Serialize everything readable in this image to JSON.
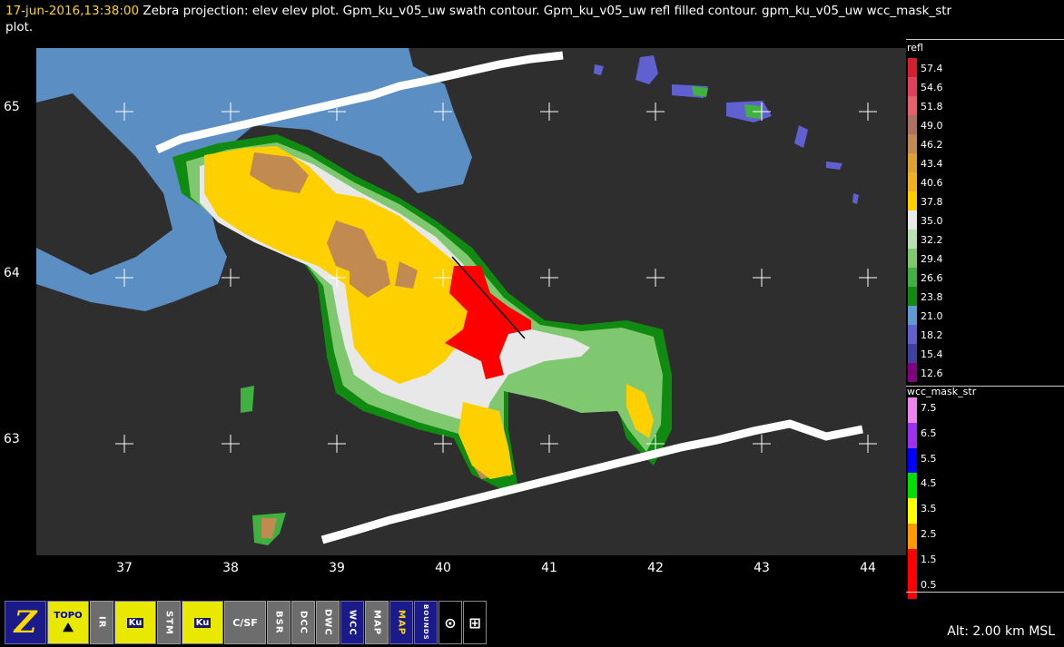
{
  "title": {
    "timestamp": "17-jun-2016,13:38:00",
    "description_line1": "  Zebra projection: elev elev  plot.  Gpm_ku_v05_uw swath contour.  Gpm_ku_v05_uw refl filled contour.  gpm_ku_v05_uw wcc_mask_str",
    "description_line2": "plot."
  },
  "axes": {
    "y_ticks": [
      "65",
      "64",
      "63"
    ],
    "x_ticks": [
      "37",
      "38",
      "39",
      "40",
      "41",
      "42",
      "43",
      "44"
    ]
  },
  "legend_refl": {
    "title": "refl",
    "entries": [
      {
        "label": "57.4",
        "color": "#d3202e"
      },
      {
        "label": "54.6",
        "color": "#e0405a"
      },
      {
        "label": "51.8",
        "color": "#e8606a"
      },
      {
        "label": "49.0",
        "color": "#b07060"
      },
      {
        "label": "46.2",
        "color": "#c08a50"
      },
      {
        "label": "43.4",
        "color": "#e0a030"
      },
      {
        "label": "40.6",
        "color": "#f0b020"
      },
      {
        "label": "37.8",
        "color": "#ffd000"
      },
      {
        "label": "35.0",
        "color": "#e8e8e8"
      },
      {
        "label": "32.2",
        "color": "#b8e0b0"
      },
      {
        "label": "29.4",
        "color": "#80c870"
      },
      {
        "label": "26.6",
        "color": "#40b040"
      },
      {
        "label": "23.8",
        "color": "#108a10"
      },
      {
        "label": "21.0",
        "color": "#5f9bd0"
      },
      {
        "label": "18.2",
        "color": "#6060d0"
      },
      {
        "label": "15.4",
        "color": "#4040a0"
      },
      {
        "label": "12.6",
        "color": "#800080"
      }
    ]
  },
  "legend_wcc": {
    "title": "wcc_mask_str",
    "entries": [
      {
        "label": "7.5",
        "color": "#ee82ee"
      },
      {
        "label": "6.5",
        "color": "#a030f0"
      },
      {
        "label": "5.5",
        "color": "#0000ff"
      },
      {
        "label": "4.5",
        "color": "#00e000"
      },
      {
        "label": "3.5",
        "color": "#ffff00"
      },
      {
        "label": "2.5",
        "color": "#ff9900"
      },
      {
        "label": "1.5",
        "color": "#ff0000"
      },
      {
        "label": "0.5",
        "color": "#ff0000"
      }
    ]
  },
  "toolbar": {
    "buttons": [
      {
        "name": "zebra-logo-button",
        "label": "Z"
      },
      {
        "name": "topo-button",
        "label": "TOPO"
      },
      {
        "name": "ir-button",
        "label": "IR"
      },
      {
        "name": "ku-button",
        "label": "Ku"
      },
      {
        "name": "stm-button",
        "label": "STM"
      },
      {
        "name": "ku-vs-button",
        "label": "Ku"
      },
      {
        "name": "csf-button",
        "label": "C/SF"
      },
      {
        "name": "bsr-button",
        "label": "BSR"
      },
      {
        "name": "dcc-button",
        "label": "DCC"
      },
      {
        "name": "dwc-button",
        "label": "DWC"
      },
      {
        "name": "wcc-button",
        "label": "WCC"
      },
      {
        "name": "map-button",
        "label": "MAP"
      },
      {
        "name": "map2-button",
        "label": "MAP"
      },
      {
        "name": "bounds-button",
        "label": "BOUNDS"
      }
    ]
  },
  "altitude": "Alt: 2.00 km MSL",
  "colors": {
    "background": "#2e2e2e",
    "water": "#5b8ec2",
    "swath": "#ffffff",
    "timestamp": "#ffd800"
  }
}
